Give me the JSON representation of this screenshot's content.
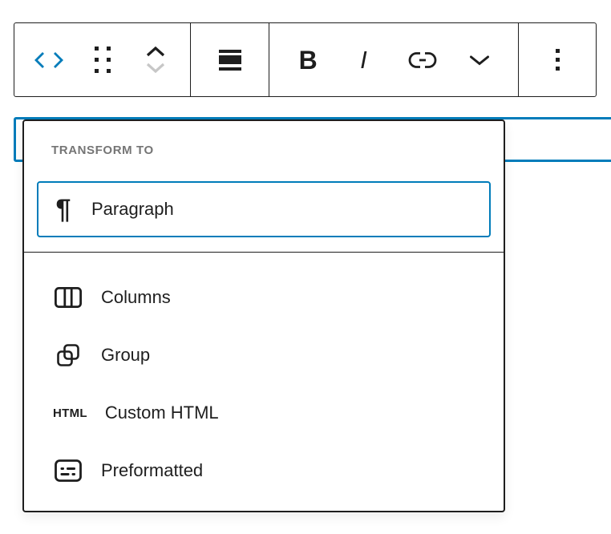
{
  "colors": {
    "accent": "#007cba",
    "border": "#1e1e1e",
    "text": "#1e1e1e",
    "muted": "#757575",
    "disabled": "#c7c7c7"
  },
  "toolbar": {
    "block_type_icon": "code-icon",
    "bold_label": "B",
    "italic_label": "I"
  },
  "transform_menu": {
    "header": "TRANSFORM TO",
    "selected_item": {
      "label": "Paragraph",
      "glyph": "¶"
    },
    "items": [
      {
        "label": "Columns"
      },
      {
        "label": "Group"
      },
      {
        "label": "Custom HTML",
        "glyph": "HTML"
      },
      {
        "label": "Preformatted"
      }
    ]
  }
}
